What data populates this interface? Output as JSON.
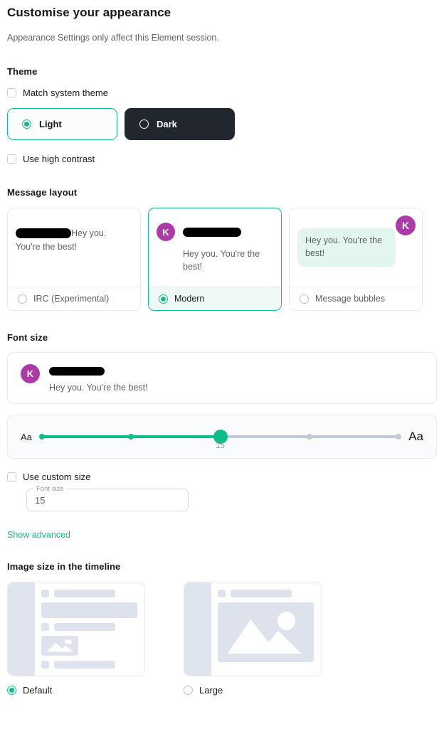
{
  "header": {
    "title": "Customise your appearance",
    "subtitle": "Appearance Settings only affect this Element session."
  },
  "theme": {
    "heading": "Theme",
    "match_system_label": "Match system theme",
    "match_system_checked": false,
    "options": [
      {
        "label": "Light",
        "selected": true
      },
      {
        "label": "Dark",
        "selected": false
      }
    ],
    "high_contrast_label": "Use high contrast",
    "high_contrast_checked": false
  },
  "message_layout": {
    "heading": "Message layout",
    "sample_text_irc": "Hey you. You're the best!",
    "sample_text_modern": "Hey you. You're the best!",
    "sample_text_bubbles": "Hey you. You're the best!",
    "avatar_initial": "K",
    "options": [
      {
        "label": "IRC (Experimental)",
        "selected": false
      },
      {
        "label": "Modern",
        "selected": true
      },
      {
        "label": "Message bubbles",
        "selected": false
      }
    ]
  },
  "font_size": {
    "heading": "Font size",
    "preview_message": "Hey you. You're the best!",
    "avatar_initial": "K",
    "small_label": "Aa",
    "large_label": "Aa",
    "value": "15",
    "slider": {
      "ticks": [
        0,
        25,
        50,
        75,
        100
      ],
      "thumb_percent": 50,
      "filled_ticks": 3
    },
    "custom_size_label": "Use custom size",
    "custom_size_checked": false,
    "custom_field_legend": "Font size",
    "custom_field_value": "15"
  },
  "advanced": {
    "show_advanced_label": "Show advanced"
  },
  "image_size": {
    "heading": "Image size in the timeline",
    "options": [
      {
        "label": "Default",
        "selected": true
      },
      {
        "label": "Large",
        "selected": false
      }
    ]
  },
  "colors": {
    "accent": "#0dbd8b",
    "avatar": "#ac3ba8",
    "bubble": "#e3f5ef",
    "dark_card": "#22262e"
  }
}
